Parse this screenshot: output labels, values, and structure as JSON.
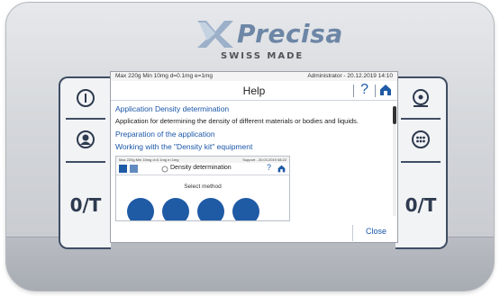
{
  "brand": {
    "name": "Precisa",
    "tagline": "SWISS MADE"
  },
  "keys": {
    "left": [
      {
        "name": "power-button",
        "icon": "power-icon"
      },
      {
        "name": "user-button",
        "icon": "user-icon"
      },
      {
        "name": "tare-left-button",
        "label": "0/T"
      }
    ],
    "right": [
      {
        "name": "print-button",
        "icon": "target-icon"
      },
      {
        "name": "menu-button",
        "icon": "dots-icon"
      },
      {
        "name": "tare-right-button",
        "label": "0/T"
      }
    ]
  },
  "screen": {
    "status_left": "Max 220g  Min 10mg  d=0.1mg  e=1mg",
    "status_right": "Administrator - 20.12.2019 14:10",
    "header_title": "Help",
    "help_symbol": "?",
    "content": {
      "title": "Application Density determination",
      "description": "Application for determining the density of different materials or bodies and liquids.",
      "link_1": "Preparation of the application",
      "link_2": "Working with the \"Density kit\" equipment"
    },
    "preview": {
      "status_left": "Max 220g  Min 10mg  d=0.1mg  e=1mg",
      "status_right": "Support - 20.03.2019 08:22",
      "title": "Density determination",
      "help_symbol": "?",
      "subtitle": "Select method"
    },
    "close_label": "Close"
  },
  "colors": {
    "accent": "#1f5aa5",
    "frame": "#3f4d63",
    "logo": "#6d86a6"
  }
}
